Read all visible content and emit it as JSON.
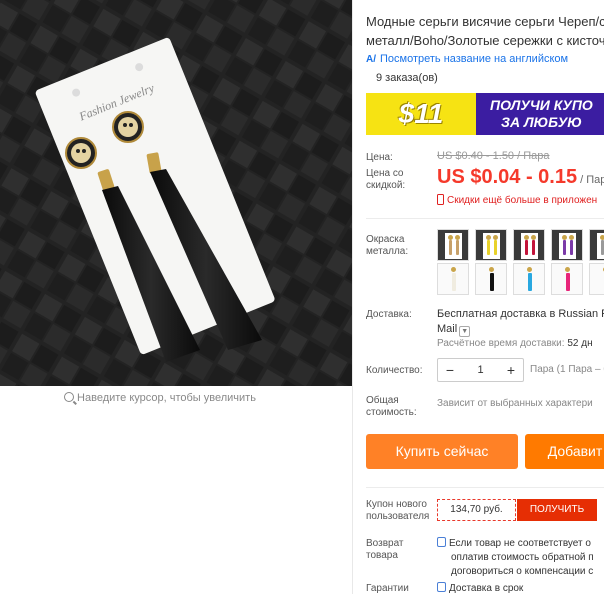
{
  "zoom_hint": "Наведите курсор, чтобы увеличить",
  "card_text": "Fashion Jewelry",
  "product": {
    "title_line1": "Модные серьги висячие серьги Череп/ст",
    "title_line2": "металл/Boho/Золотые сережки с кисточ",
    "translate_link": "Посмотреть название на английском",
    "orders": "9 заказа(ов)"
  },
  "coupon_banner": {
    "amount": "$11",
    "text_line1": "ПОЛУЧИ КУПО",
    "text_line2": "ЗА ЛЮБУЮ"
  },
  "price": {
    "label": "Цена:",
    "old": "US $0.40 - 1.50 / Пара",
    "discount_label_1": "Цена со",
    "discount_label_2": "скидкой:",
    "current": "US $0.04 - 0.15",
    "unit": "/ Пара",
    "app_discount": "Скидки ещё больше в приложен"
  },
  "color": {
    "label_1": "Окраска",
    "label_2": "металла:"
  },
  "shipping": {
    "label": "Доставка:",
    "line1_bold": "Бесплатная доставка",
    "line1_rest": " в Russian F",
    "line2": "Mail",
    "time_label": "Расчётное время доставки:",
    "time_value": "52 дн"
  },
  "quantity": {
    "label": "Количество:",
    "minus": "−",
    "value": "1",
    "plus": "+",
    "pack_info": "Пара (1 Пара – б"
  },
  "total": {
    "label_1": "Общая",
    "label_2": "стоимость:",
    "value": "Зависит от выбранных характери"
  },
  "buttons": {
    "buy": "Купить сейчас",
    "cart": "Добавит"
  },
  "new_user_coupon": {
    "label_1": "Купон нового",
    "label_2": "пользователя",
    "value": "134,70 руб.",
    "button": "ПОЛУЧИТЬ"
  },
  "returns": {
    "label_1": "Возврат",
    "label_2": "товара",
    "line1": "Если товар не соответствует о",
    "line2": "оплатив стоимость обратной п",
    "line3": "договориться о компенсации с"
  },
  "guarantee": {
    "label": "Гарантии",
    "value": "Доставка в срок"
  },
  "colors": {
    "accent": "#f5392b",
    "buy_button": "#ff8126",
    "cart_button": "#ff7a00",
    "link": "#1a73e8",
    "banner": "#3b1da1",
    "banner_amount_bg": "#f6e313"
  }
}
